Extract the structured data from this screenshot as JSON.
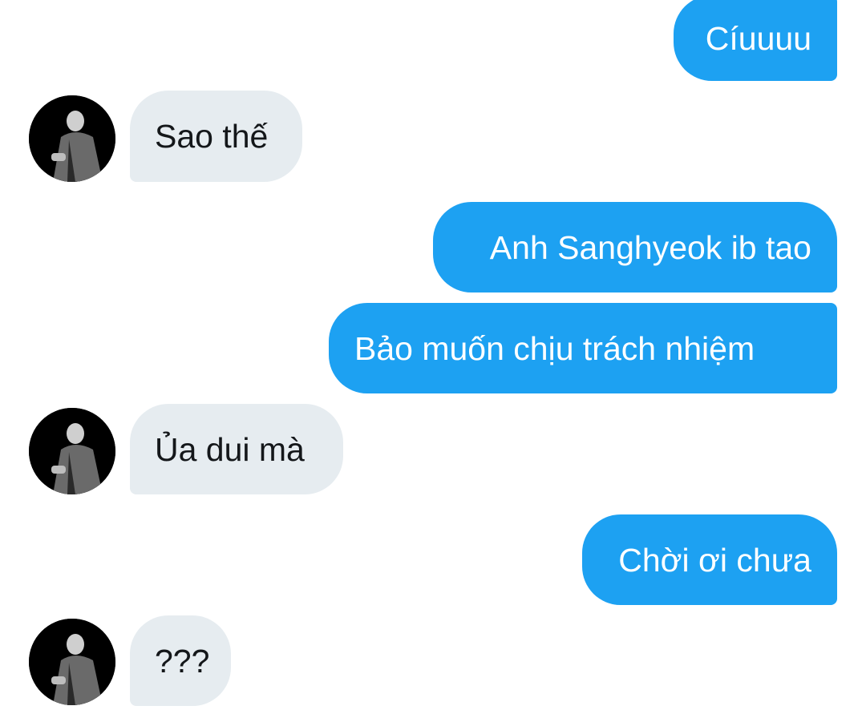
{
  "conversation": {
    "messages": [
      {
        "direction": "outgoing",
        "text": "Cíuuuu"
      },
      {
        "direction": "incoming",
        "text": "Sao thế"
      },
      {
        "direction": "outgoing",
        "text": "Anh Sanghyeok ib tao"
      },
      {
        "direction": "outgoing",
        "text": "Bảo muốn chịu trách nhiệm"
      },
      {
        "direction": "incoming",
        "text": "Ủa dui mà"
      },
      {
        "direction": "outgoing",
        "text": "Chời ơi chưa"
      },
      {
        "direction": "incoming",
        "text": "???"
      }
    ]
  },
  "colors": {
    "outgoing_bubble": "#1da1f2",
    "incoming_bubble": "#e6ecf0",
    "outgoing_text": "#ffffff",
    "incoming_text": "#14171a"
  },
  "icons": {
    "avatar": "profile-photo-avatar"
  }
}
